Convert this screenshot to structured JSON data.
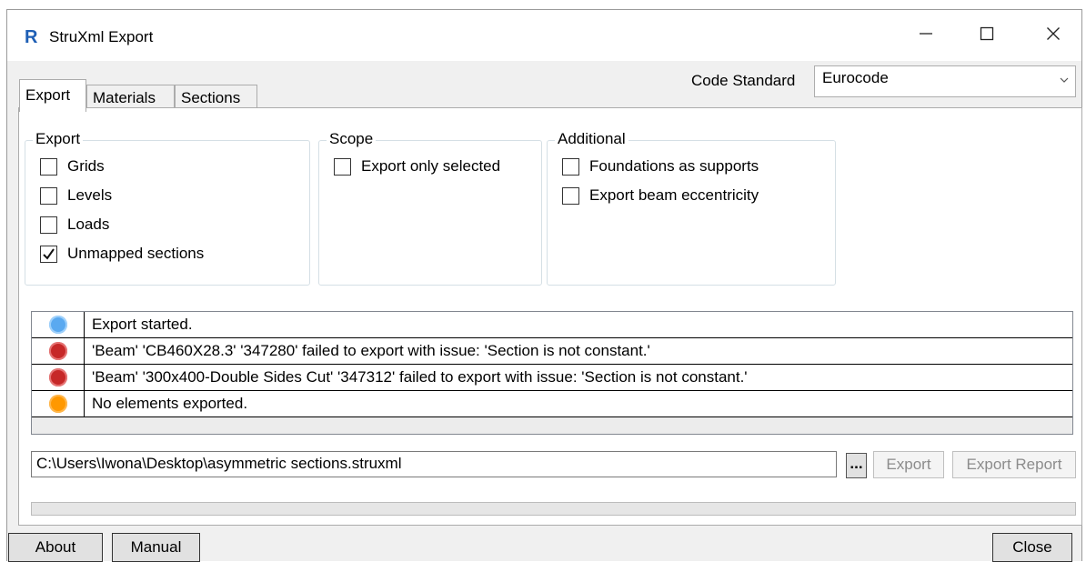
{
  "window": {
    "title": "StruXml Export",
    "app_icon_letter": "R",
    "controls": {
      "minimize": "minimize-icon",
      "maximize": "maximize-icon",
      "close": "close-icon"
    }
  },
  "tabs": [
    {
      "label": "Export",
      "active": true
    },
    {
      "label": "Materials",
      "active": false
    },
    {
      "label": "Sections",
      "active": false
    }
  ],
  "code_standard": {
    "label": "Code Standard",
    "value": "Eurocode"
  },
  "groups": {
    "export": {
      "title": "Export",
      "items": [
        {
          "label": "Grids",
          "checked": false
        },
        {
          "label": "Levels",
          "checked": false
        },
        {
          "label": "Loads",
          "checked": false
        },
        {
          "label": "Unmapped sections",
          "checked": true
        }
      ]
    },
    "scope": {
      "title": "Scope",
      "items": [
        {
          "label": "Export only selected",
          "checked": false
        }
      ]
    },
    "additional": {
      "title": "Additional",
      "items": [
        {
          "label": "Foundations as supports",
          "checked": false
        },
        {
          "label": "Export beam eccentricity",
          "checked": false
        }
      ]
    }
  },
  "log": [
    {
      "status": "info",
      "color": "#5aa9f0",
      "message": "Export started."
    },
    {
      "status": "error",
      "color": "#c62828",
      "message": "'Beam' 'CB460X28.3' '347280' failed to export with issue: 'Section is not constant.'"
    },
    {
      "status": "error",
      "color": "#c62828",
      "message": "'Beam' '300x400-Double Sides Cut' '347312' failed to export with issue: 'Section is not constant.'"
    },
    {
      "status": "warning",
      "color": "#ff9800",
      "message": "No elements exported."
    }
  ],
  "output": {
    "path": "C:\\Users\\Iwona\\Desktop\\asymmetric sections.struxml",
    "browse_label": "...",
    "export_label": "Export",
    "export_report_label": "Export Report"
  },
  "progress": 0,
  "footer": {
    "about_label": "About",
    "manual_label": "Manual",
    "close_label": "Close"
  }
}
